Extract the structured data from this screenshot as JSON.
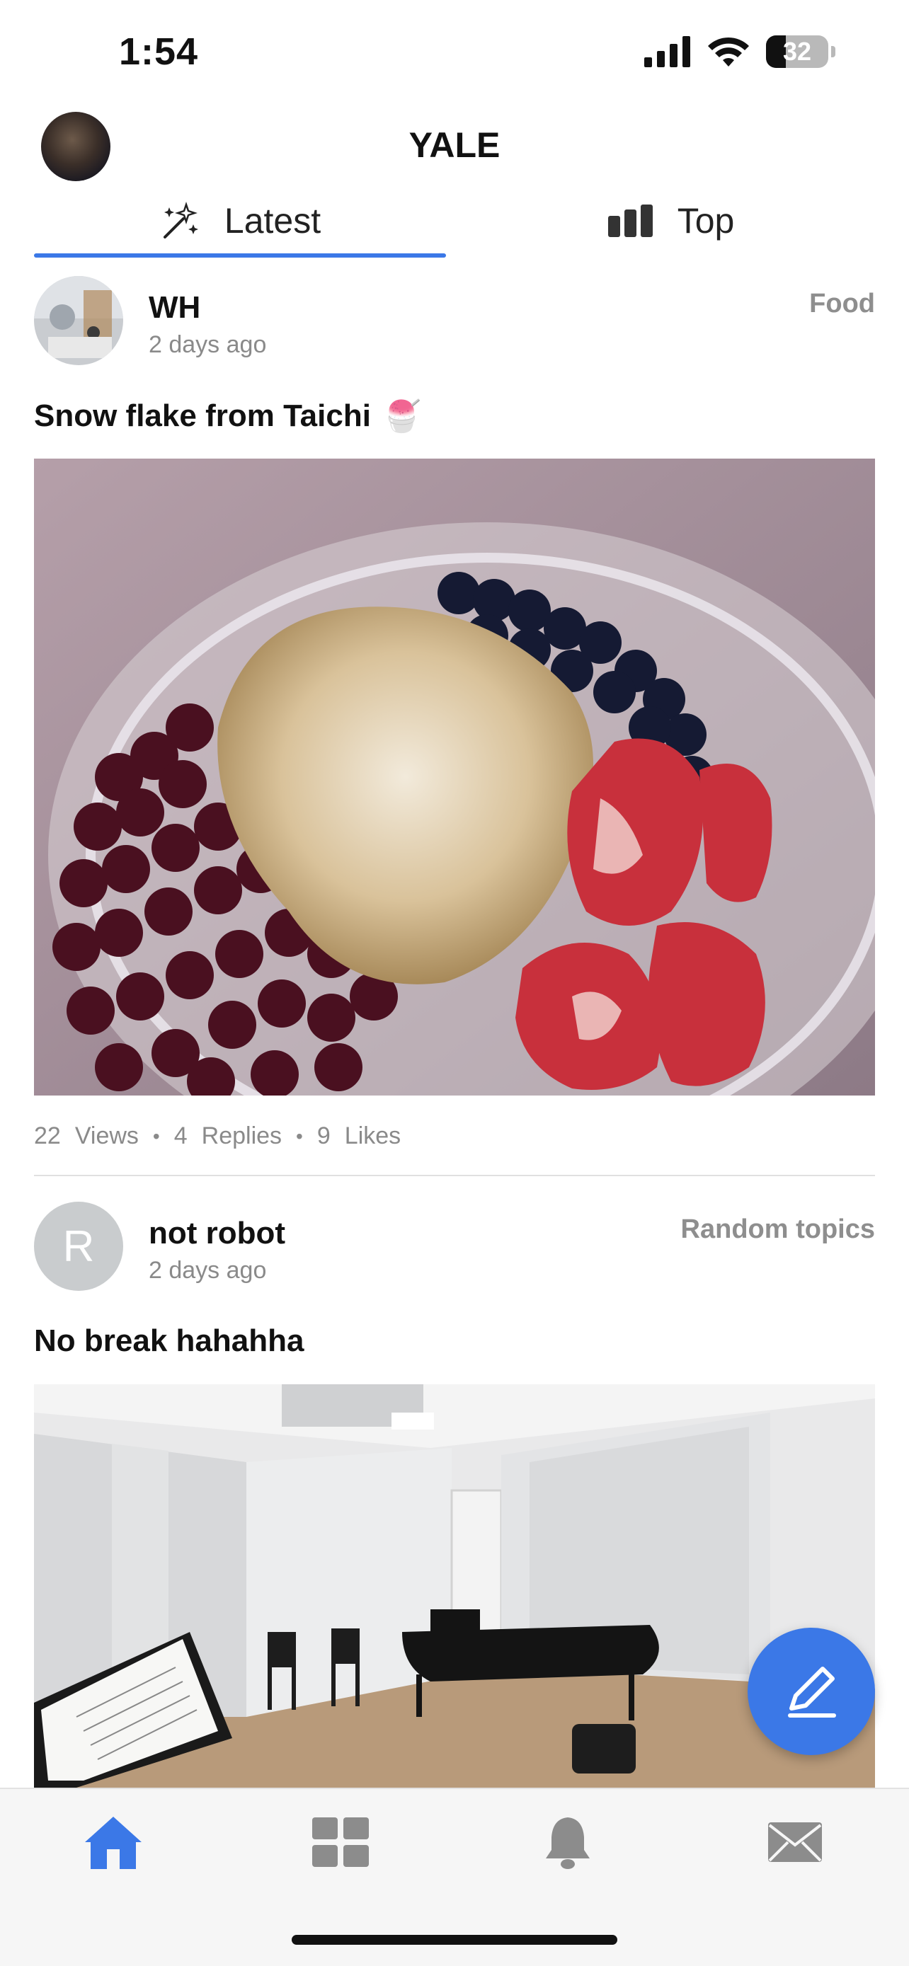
{
  "status_bar": {
    "time": "1:54",
    "battery_percent": 32
  },
  "header": {
    "title": "YALE"
  },
  "tabs": [
    {
      "label": "Latest",
      "icon": "sparkles-icon",
      "active": true
    },
    {
      "label": "Top",
      "icon": "bar-chart-icon",
      "active": false
    }
  ],
  "posts": [
    {
      "author": "WH",
      "time": "2 days ago",
      "category": "Food",
      "title": "Snow flake from Taichi",
      "title_emoji": "🍧",
      "stats": {
        "views": "22",
        "views_label": "Views",
        "replies": "4",
        "replies_label": "Replies",
        "likes": "9",
        "likes_label": "Likes"
      }
    },
    {
      "author": "not robot",
      "avatar_letter": "R",
      "time": "2 days ago",
      "category": "Random topics",
      "title": "No break hahahha"
    }
  ],
  "bottom_nav": [
    {
      "name": "home-icon",
      "active": true
    },
    {
      "name": "categories-icon",
      "active": false
    },
    {
      "name": "bell-icon",
      "active": false
    },
    {
      "name": "mail-icon",
      "active": false
    }
  ],
  "colors": {
    "accent": "#3b78e7",
    "muted": "#8a8a8a",
    "nav_inactive": "#8c8c8c"
  }
}
